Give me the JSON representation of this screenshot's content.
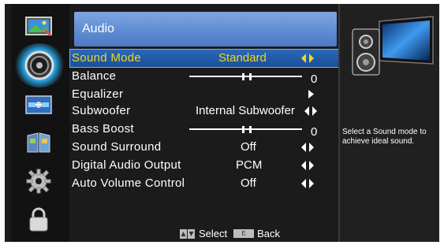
{
  "sidebar": {
    "items": [
      {
        "name": "picture",
        "icon": "picture-icon"
      },
      {
        "name": "audio",
        "icon": "speaker-icon",
        "selected": true
      },
      {
        "name": "channel",
        "icon": "satellite-icon"
      },
      {
        "name": "parental",
        "icon": "book-icon"
      },
      {
        "name": "setup",
        "icon": "gear-icon"
      },
      {
        "name": "lock",
        "icon": "lock-icon"
      }
    ]
  },
  "header": {
    "title": "Audio"
  },
  "menu": {
    "sound_mode": {
      "label": "Sound Mode",
      "value": "Standard"
    },
    "balance": {
      "label": "Balance",
      "value": "0"
    },
    "equalizer": {
      "label": "Equalizer"
    },
    "subwoofer": {
      "label": "Subwoofer",
      "value": "Internal Subwoofer"
    },
    "bass_boost": {
      "label": "Bass Boost",
      "value": "0"
    },
    "sound_surround": {
      "label": "Sound Surround",
      "value": "Off"
    },
    "digital_audio_output": {
      "label": "Digital Audio Output",
      "value": "PCM"
    },
    "auto_volume_control": {
      "label": "Auto Volume Control",
      "value": "Off"
    }
  },
  "footer": {
    "select_label": "Select",
    "back_key": "E",
    "back_label": "Back"
  },
  "help": {
    "text": "Select a Sound mode to achieve ideal sound."
  },
  "colors": {
    "selected_text": "#f1d51f",
    "highlight": "#1a4f96",
    "title_bar": "#5f8cd3"
  }
}
